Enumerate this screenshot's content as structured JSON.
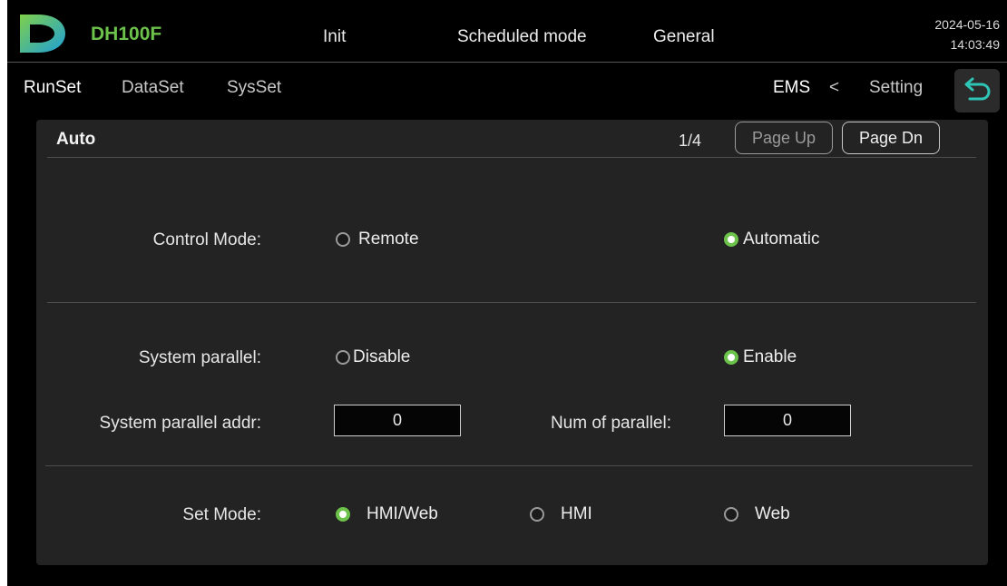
{
  "header": {
    "model": "DH100F",
    "status": "Init",
    "mode": "Scheduled mode",
    "type": "General",
    "date": "2024-05-16",
    "time": "14:03:49",
    "logo_icon": "d-logo-icon",
    "brand_color": "#6cc24a"
  },
  "nav": {
    "tabs": [
      "RunSet",
      "DataSet",
      "SysSet"
    ],
    "breadcrumb_root": "EMS",
    "breadcrumb_sep": "<",
    "breadcrumb_current": "Setting",
    "back_icon": "return-arrow-icon"
  },
  "panel": {
    "title": "Auto",
    "page": "1/4",
    "page_up": "Page Up",
    "page_dn": "Page Dn"
  },
  "settings": {
    "control_mode": {
      "label": "Control Mode:",
      "options": [
        "Remote",
        "Automatic"
      ],
      "selected": "Automatic"
    },
    "system_parallel": {
      "label": "System parallel:",
      "options": [
        "Disable",
        "Enable"
      ],
      "selected": "Enable"
    },
    "parallel_addr": {
      "label": "System parallel addr:",
      "value": "0"
    },
    "num_parallel": {
      "label": "Num of parallel:",
      "value": "0"
    },
    "set_mode": {
      "label": "Set Mode:",
      "options": [
        "HMI/Web",
        "HMI",
        "Web"
      ],
      "selected": "HMI/Web"
    }
  }
}
